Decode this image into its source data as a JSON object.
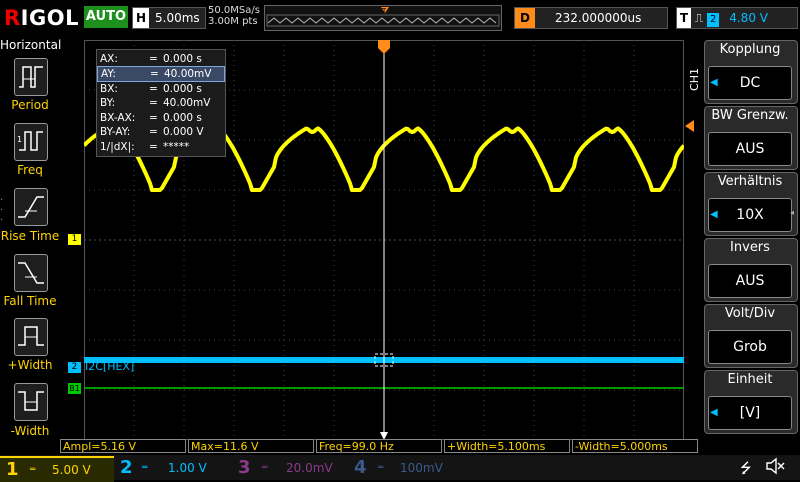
{
  "header": {
    "brand_main": "IGOL",
    "brand_r": "R",
    "mode": "AUTO",
    "h_label": "H",
    "timebase": "5.00ms",
    "sample_rate": "50.0MSa/s",
    "points": "3.00M pts",
    "delay_label": "D",
    "delay_value": "232.000000us",
    "trig_label": "T",
    "trig_channel": "2",
    "trig_level": "4.80 V"
  },
  "left_menu": {
    "title": "Horizontal",
    "items": [
      {
        "label": "Period"
      },
      {
        "label": "Freq"
      },
      {
        "label": "Rise Time"
      },
      {
        "label": "Fall Time"
      },
      {
        "label": "+Width"
      },
      {
        "label": "-Width"
      }
    ]
  },
  "right_menu": {
    "channel_tag": "CH1",
    "items": [
      {
        "title": "Kopplung",
        "value": "DC"
      },
      {
        "title": "BW Grenzw.",
        "value": "AUS"
      },
      {
        "title": "Verhältnis",
        "value": "10X"
      },
      {
        "title": "Invers",
        "value": "AUS"
      },
      {
        "title": "Volt/Div",
        "value": "Grob"
      },
      {
        "title": "Einheit",
        "value": "[V]"
      }
    ]
  },
  "cursor": {
    "rows": [
      {
        "key": "AX:",
        "eq": "=",
        "value": "0.000 s"
      },
      {
        "key": "AY:",
        "eq": "=",
        "value": "40.00mV"
      },
      {
        "key": "BX:",
        "eq": "=",
        "value": "0.000 s"
      },
      {
        "key": "BY:",
        "eq": "=",
        "value": "40.00mV"
      },
      {
        "key": "BX-AX:",
        "eq": "=",
        "value": "0.000 s"
      },
      {
        "key": "BY-AY:",
        "eq": "=",
        "value": "0.000 V"
      },
      {
        "key": "1/|dX|:",
        "eq": "=",
        "value": "*****"
      }
    ],
    "selected_index": 1
  },
  "traces": {
    "ch1_marker": "1",
    "ch2_marker": "2",
    "bus_marker": "B1",
    "bus_label": "I2C[HEX]",
    "ch1_color": "#ffff00",
    "ch2_color": "#00bfff",
    "bus_color": "#00c800"
  },
  "measurements": [
    {
      "text": "Ampl=5.16 V"
    },
    {
      "text": "Max=11.6 V"
    },
    {
      "text": "Freq=99.0 Hz"
    },
    {
      "text": "+Width=5.100ms"
    },
    {
      "text": "-Width=5.000ms"
    }
  ],
  "channels": [
    {
      "num": "1",
      "value": "5.00 V",
      "color": "#ffd400"
    },
    {
      "num": "2",
      "value": "1.00 V",
      "color": "#00bfff"
    },
    {
      "num": "3",
      "value": "20.0mV",
      "color": "#8a3a8a"
    },
    {
      "num": "4",
      "value": "100mV",
      "color": "#3a5a8a"
    }
  ],
  "status_icons": [
    "usb-icon",
    "speaker-muted-icon"
  ]
}
